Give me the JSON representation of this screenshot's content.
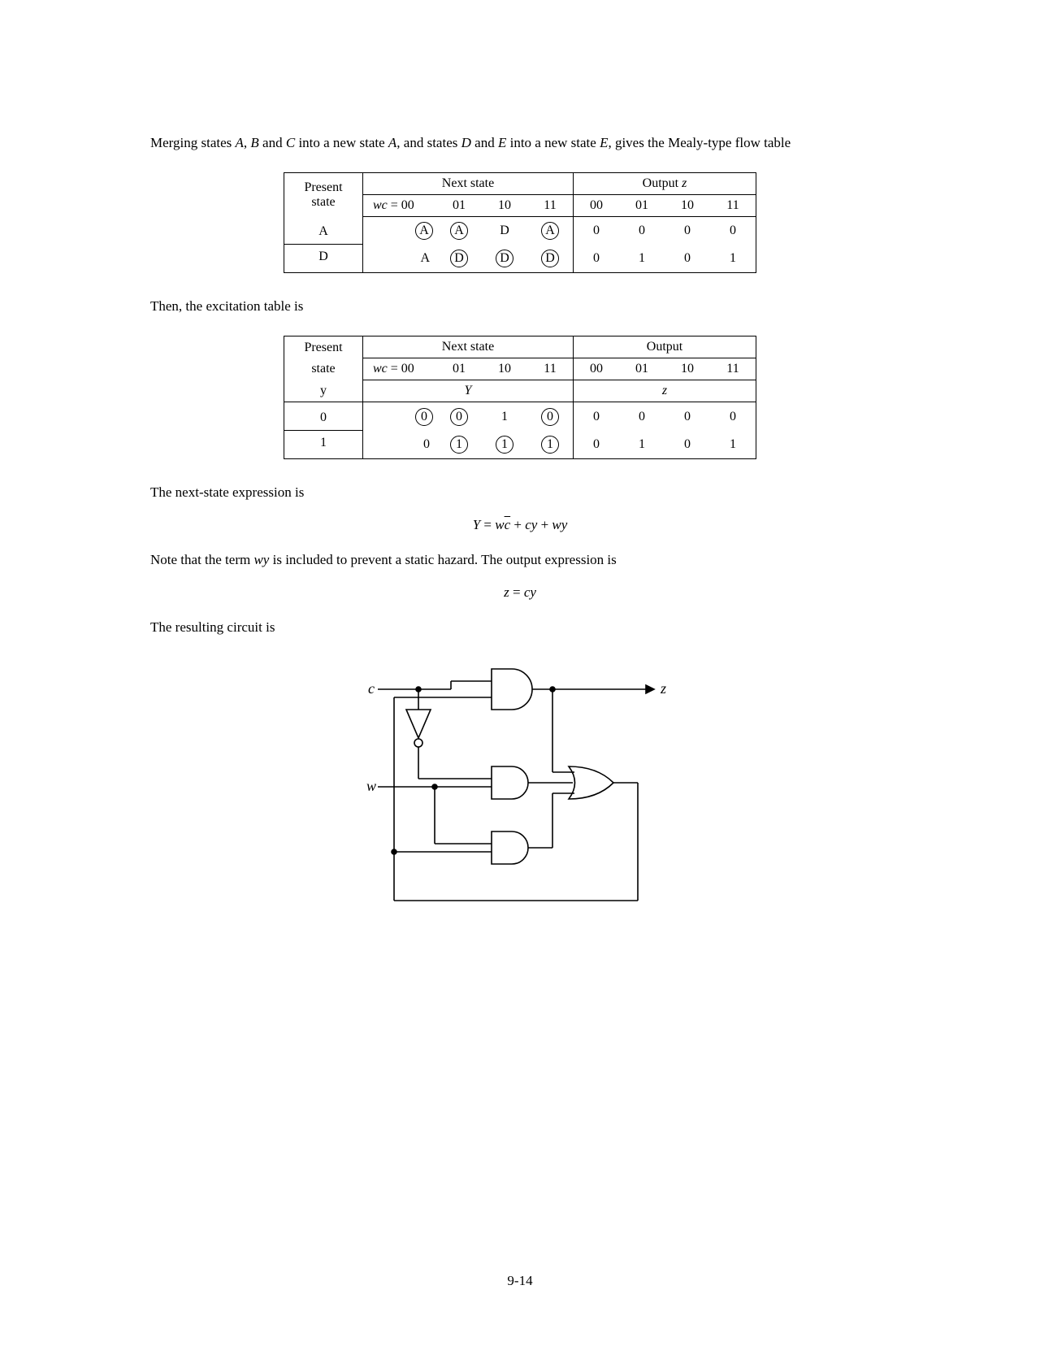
{
  "para1_prefix": "Merging states ",
  "para1_s1": "A",
  "para1_c1": ", ",
  "para1_s2": "B",
  "para1_c2": " and ",
  "para1_s3": "C",
  "para1_mid1": " into a new state ",
  "para1_s4": "A",
  "para1_c3": ", and states ",
  "para1_s5": "D",
  "para1_c4": " and ",
  "para1_s6": "E",
  "para1_mid2": " into a new state ",
  "para1_s7": "E",
  "para1_suffix": ", gives the Mealy-type flow table",
  "t1": {
    "present": "Present",
    "state": "state",
    "nextstate": "Next state",
    "outputz": "Output z",
    "wc": "wc",
    "eq00": " = 00",
    "c01": "01",
    "c10": "10",
    "c11": "11",
    "o00": "00",
    "o01": "01",
    "o10": "10",
    "o11": "11",
    "rowA_label": "A",
    "rowA": [
      "A",
      "A",
      "D",
      "A"
    ],
    "rowA_circ": [
      true,
      true,
      false,
      true
    ],
    "rowA_out": [
      "0",
      "0",
      "0",
      "0"
    ],
    "rowD_label": "D",
    "rowD": [
      "A",
      "D",
      "D",
      "D"
    ],
    "rowD_circ": [
      false,
      true,
      true,
      true
    ],
    "rowD_out": [
      "0",
      "1",
      "0",
      "1"
    ]
  },
  "para2": "Then, the excitation table is",
  "t2": {
    "present": "Present",
    "state": "state",
    "y": "y",
    "nextstate": "Next state",
    "output": "Output",
    "wc": "wc",
    "eq00": " = 00",
    "c01": "01",
    "c10": "10",
    "c11": "11",
    "o00": "00",
    "o01": "01",
    "o10": "10",
    "o11": "11",
    "Y": "Y",
    "z": "z",
    "row0_label": "0",
    "row0": [
      "0",
      "0",
      "1",
      "0"
    ],
    "row0_circ": [
      true,
      true,
      false,
      true
    ],
    "row0_out": [
      "0",
      "0",
      "0",
      "0"
    ],
    "row1_label": "1",
    "row1": [
      "0",
      "1",
      "1",
      "1"
    ],
    "row1_circ": [
      false,
      true,
      true,
      true
    ],
    "row1_out": [
      "0",
      "1",
      "0",
      "1"
    ]
  },
  "para3": "The next-state expression is",
  "eq1_lhs": "Y",
  "eq1_eq": " = ",
  "eq1_t1a": "w",
  "eq1_t1b": "c",
  "eq1_plus1": " + ",
  "eq1_t2": "cy",
  "eq1_plus2": " + ",
  "eq1_t3": "wy",
  "para4_prefix": "Note that the term ",
  "para4_term": "wy",
  "para4_suffix": " is included to prevent a static hazard. The output expression is",
  "eq2_lhs": "z",
  "eq2_eq": " = ",
  "eq2_rhs": "cy",
  "para5": "The resulting circuit is",
  "circuit": {
    "c": "c",
    "w": "w",
    "z": "z"
  },
  "pagenum": "9-14"
}
